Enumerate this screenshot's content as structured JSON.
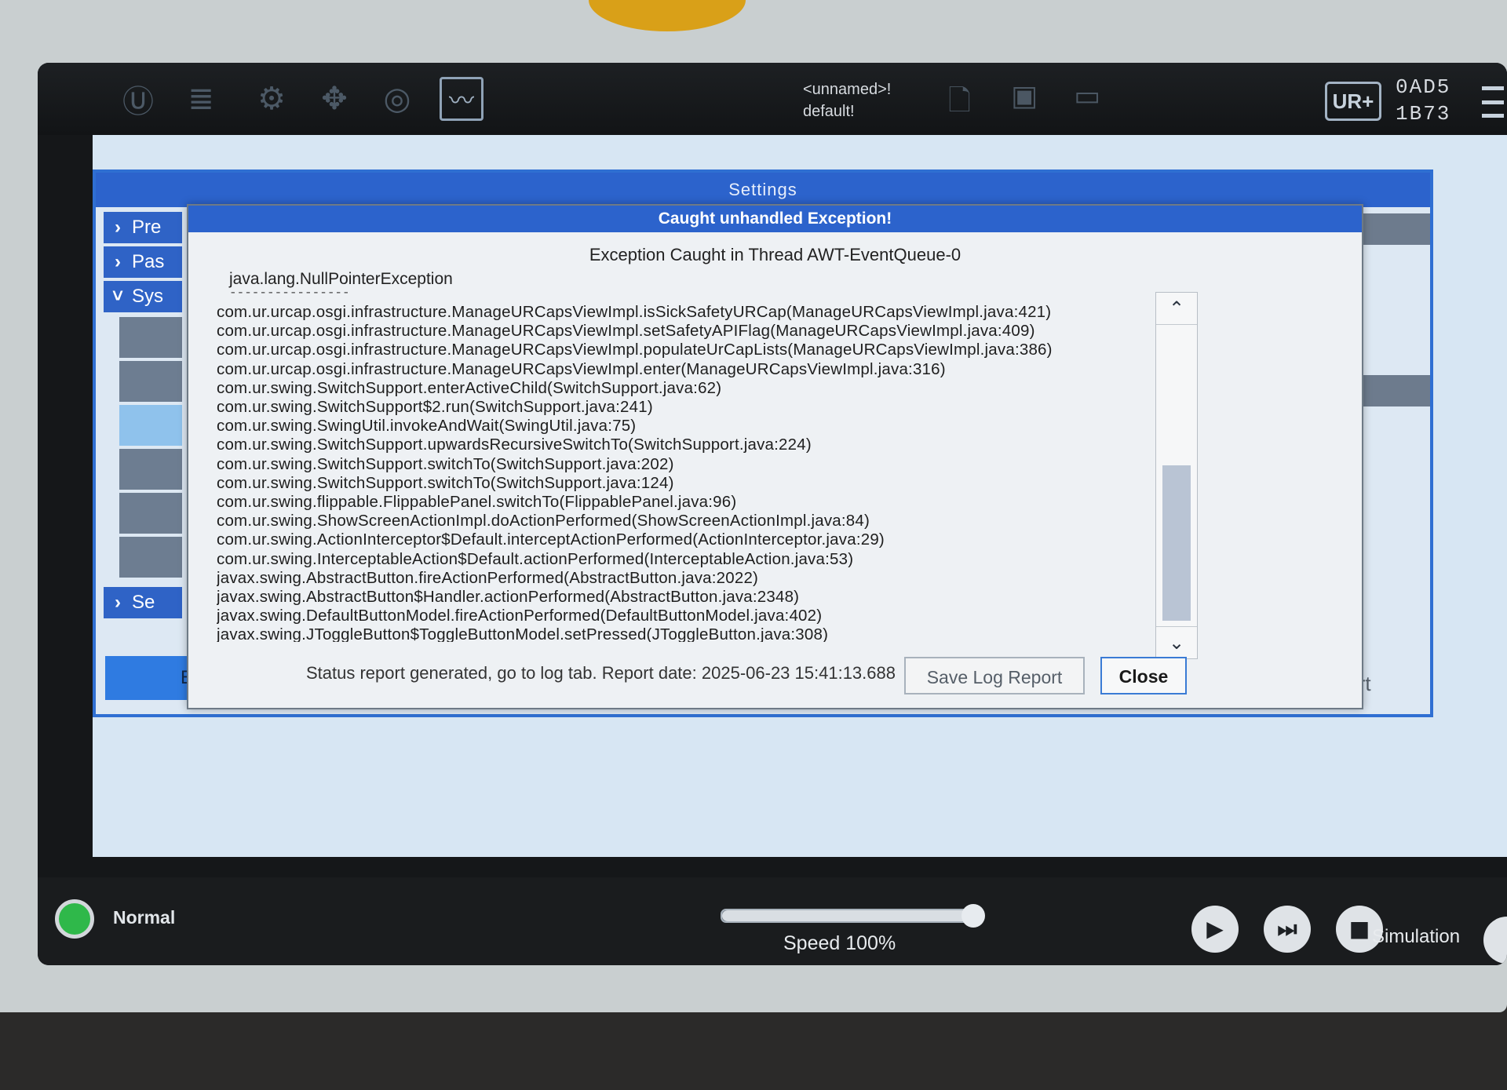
{
  "topbar": {
    "program_name": "<unnamed>!",
    "installation_name": "default!",
    "ur_plus_label": "UR+",
    "serial_line1": "0AD5",
    "serial_line2": "1B73",
    "icons": [
      "ur-logo-icon",
      "program-icon",
      "installation-icon",
      "move-icon",
      "io-icon",
      "log-icon",
      "new-file-icon",
      "open-file-icon",
      "save-file-icon",
      "menu-icon"
    ]
  },
  "settings": {
    "header": "Settings",
    "side_items": [
      {
        "label": "Preferences",
        "visible": "Pre"
      },
      {
        "label": "Password",
        "visible": "Pas"
      },
      {
        "label": "System",
        "visible": "Sys"
      },
      {
        "label": "Security",
        "visible": "Se"
      }
    ],
    "exit_label": "Exit",
    "restart_label": "start"
  },
  "dialog": {
    "title": "Caught unhandled Exception!",
    "thread_line": "Exception Caught in Thread AWT-EventQueue-0",
    "exception_type": "java.lang.NullPointerException",
    "separator": "----------------",
    "stack_trace": [
      "com.ur.urcap.osgi.infrastructure.ManageURCapsViewImpl.isSickSafetyURCap(ManageURCapsViewImpl.java:421)",
      "com.ur.urcap.osgi.infrastructure.ManageURCapsViewImpl.setSafetyAPIFlag(ManageURCapsViewImpl.java:409)",
      "com.ur.urcap.osgi.infrastructure.ManageURCapsViewImpl.populateUrCapLists(ManageURCapsViewImpl.java:386)",
      "com.ur.urcap.osgi.infrastructure.ManageURCapsViewImpl.enter(ManageURCapsViewImpl.java:316)",
      "com.ur.swing.SwitchSupport.enterActiveChild(SwitchSupport.java:62)",
      "com.ur.swing.SwitchSupport$2.run(SwitchSupport.java:241)",
      "com.ur.swing.SwingUtil.invokeAndWait(SwingUtil.java:75)",
      "com.ur.swing.SwitchSupport.upwardsRecursiveSwitchTo(SwitchSupport.java:224)",
      "com.ur.swing.SwitchSupport.switchTo(SwitchSupport.java:202)",
      "com.ur.swing.SwitchSupport.switchTo(SwitchSupport.java:124)",
      "com.ur.swing.flippable.FlippablePanel.switchTo(FlippablePanel.java:96)",
      "com.ur.swing.ShowScreenActionImpl.doActionPerformed(ShowScreenActionImpl.java:84)",
      "com.ur.swing.ActionInterceptor$Default.interceptActionPerformed(ActionInterceptor.java:29)",
      "com.ur.swing.InterceptableAction$Default.actionPerformed(InterceptableAction.java:53)",
      "javax.swing.AbstractButton.fireActionPerformed(AbstractButton.java:2022)",
      "javax.swing.AbstractButton$Handler.actionPerformed(AbstractButton.java:2348)",
      "javax.swing.DefaultButtonModel.fireActionPerformed(DefaultButtonModel.java:402)",
      "javax.swing.JToggleButton$ToggleButtonModel.setPressed(JToggleButton.java:308)"
    ],
    "status_line": "Status report generated, go to log tab. Report date: 2025-06-23 15:41:13.688",
    "save_button": "Save Log Report",
    "close_button": "Close",
    "scroll_up": "^",
    "scroll_down": "v"
  },
  "footer": {
    "status": "Normal",
    "status_color": "#2fb84a",
    "speed_label": "Speed 100%",
    "speed_fraction": 1.0,
    "play_icon": "▶",
    "step_icon": "⏭",
    "stop_icon": "■",
    "simulation_label": "Simulation"
  },
  "colors": {
    "accent_blue": "#2c63cc",
    "dialog_bg": "#eef1f4"
  }
}
